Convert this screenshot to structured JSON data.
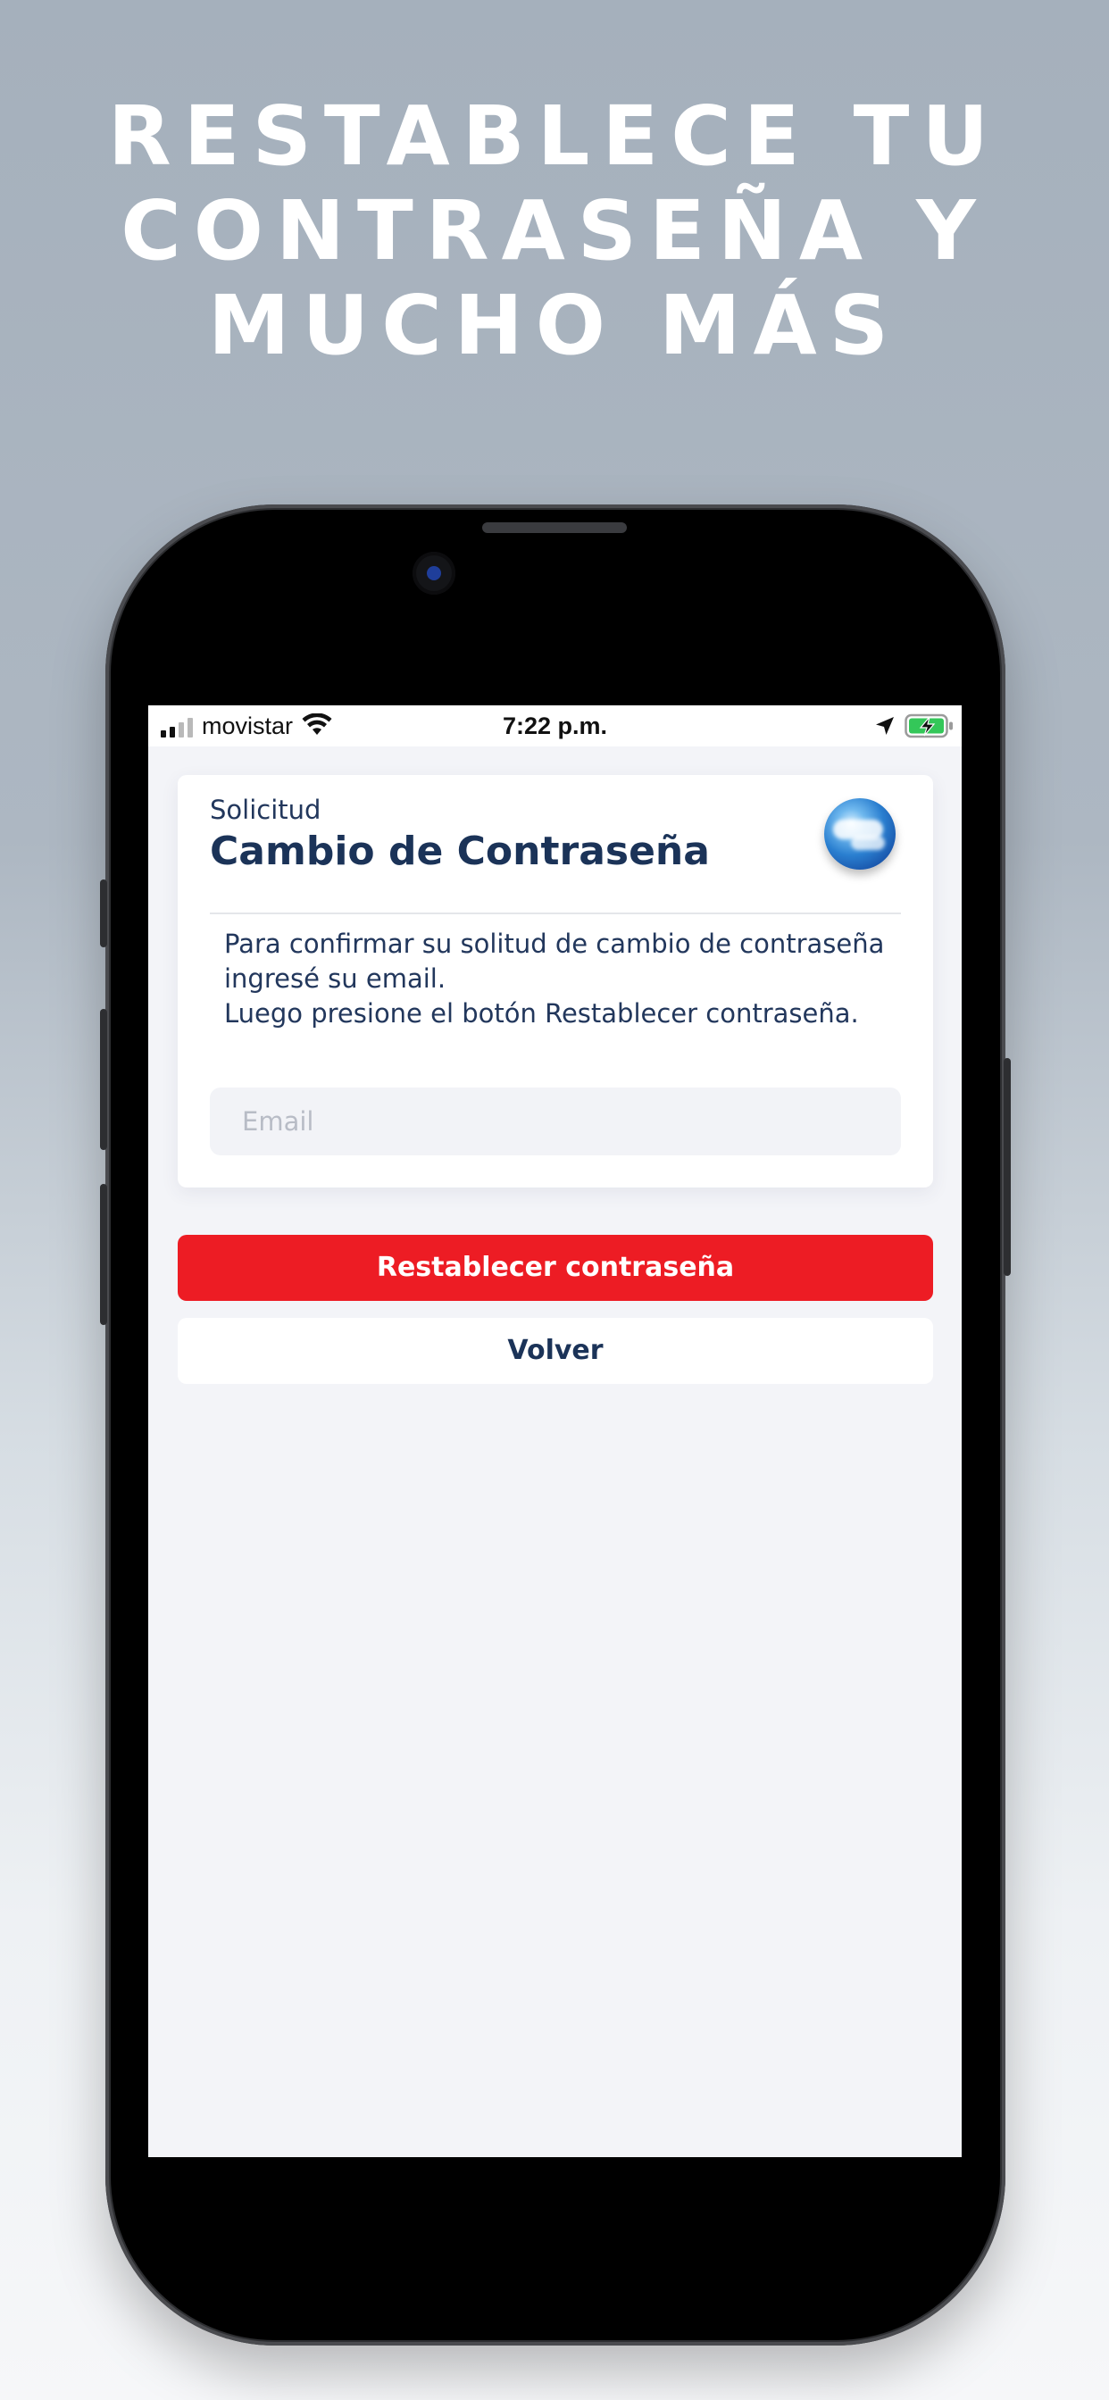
{
  "headline": {
    "line1": "RESTABLECE TU",
    "line2": "CONTRASEÑA Y",
    "line3": "MUCHO MÁS"
  },
  "status_bar": {
    "carrier": "movistar",
    "time": "7:22 p.m.",
    "signal_bars_filled": 2,
    "signal_bars_total": 4,
    "icons": [
      "signal-icon",
      "wifi-icon",
      "location-arrow-icon",
      "battery-charging-icon"
    ]
  },
  "card": {
    "kicker": "Solicitud",
    "title": "Cambio de Contraseña",
    "logo_icon": "globe-icon",
    "message_line1": "Para confirmar su solitud de cambio de contraseña",
    "message_line2": "ingresé su email.",
    "message_line3": "Luego presione el botón Restablecer contraseña.",
    "email_placeholder": "Email",
    "email_value": ""
  },
  "actions": {
    "reset_label": "Restablecer contraseña",
    "back_label": "Volver"
  },
  "colors": {
    "accent_red": "#ed1c24",
    "navy_text": "#1b3358",
    "screen_bg": "#f3f4f8",
    "battery_green": "#34c759"
  }
}
